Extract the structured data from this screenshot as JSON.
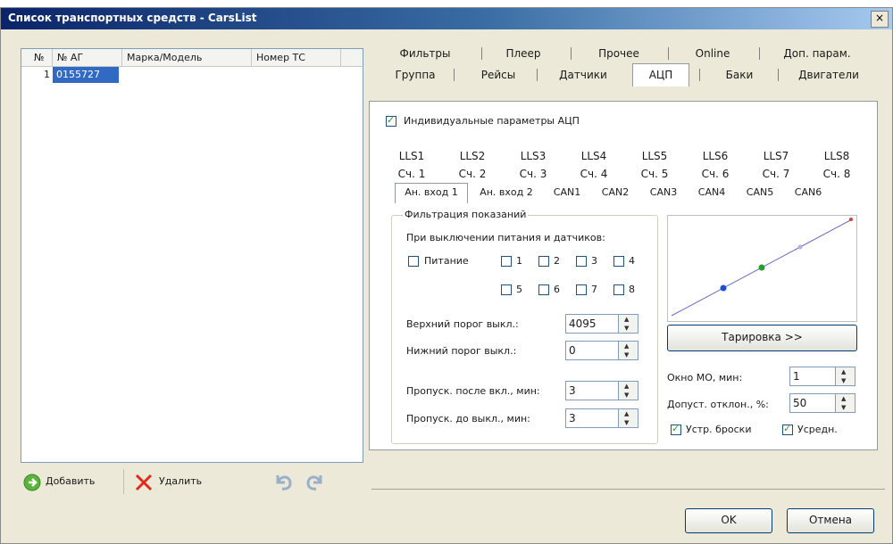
{
  "window": {
    "title": "Список транспортных средств - CarsList",
    "close_label": "×"
  },
  "list": {
    "columns": [
      "№",
      "№ АГ",
      "Марка/Модель",
      "Номер ТС"
    ],
    "rows": [
      {
        "num": "1",
        "ag": "0155727",
        "model": "",
        "plate": ""
      }
    ]
  },
  "list_toolbar": {
    "add_label": "Добавить",
    "delete_label": "Удалить"
  },
  "tabs": {
    "row1": [
      "Фильтры",
      "Плеер",
      "Прочее",
      "Online",
      "Доп. парам."
    ],
    "row2": [
      "Группа",
      "Рейсы",
      "Датчики",
      "АЦП",
      "Баки",
      "Двигатели"
    ],
    "active": "АЦП"
  },
  "adc": {
    "individual_label": "Индивидуальные параметры АЦП",
    "individual_checked": true,
    "subtabs_row1": [
      "LLS1",
      "LLS2",
      "LLS3",
      "LLS4",
      "LLS5",
      "LLS6",
      "LLS7",
      "LLS8"
    ],
    "subtabs_row2": [
      "Сч. 1",
      "Сч. 2",
      "Сч. 3",
      "Сч. 4",
      "Сч. 5",
      "Сч. 6",
      "Сч. 7",
      "Сч. 8"
    ],
    "subtabs_row3": [
      "Ан. вход 1",
      "Ан. вход 2",
      "CAN1",
      "CAN2",
      "CAN3",
      "CAN4",
      "CAN5",
      "CAN6"
    ],
    "active_subtab": "Ан. вход 1"
  },
  "filter": {
    "group_title": "Фильтрация показаний",
    "power_off_label": "При выключении питания и датчиков:",
    "power_label": "Питание",
    "sensors": [
      "1",
      "2",
      "3",
      "4",
      "5",
      "6",
      "7",
      "8"
    ],
    "upper_label": "Верхний порог выкл.:",
    "upper_value": "4095",
    "lower_label": "Нижний порог выкл.:",
    "lower_value": "0",
    "skip_after_label": "Пропуск. после вкл., мин:",
    "skip_after_value": "3",
    "skip_before_label": "Пропуск. до выкл., мин:",
    "skip_before_value": "3"
  },
  "calibration": {
    "button_label": "Тарировка >>",
    "window_label": "Окно МО, мин:",
    "window_value": "1",
    "deviation_label": "Допуст. отклон., %:",
    "deviation_value": "50",
    "remove_spikes_label": "Устр. броски",
    "remove_spikes_checked": true,
    "average_label": "Усредн.",
    "average_checked": true,
    "curve_color": "#6a6acb",
    "point_colors": [
      "#1a4fd6",
      "#2c9a2c",
      "#b0b0e8",
      "#d04040"
    ]
  },
  "dialog": {
    "ok_label": "OK",
    "cancel_label": "Отмена"
  }
}
